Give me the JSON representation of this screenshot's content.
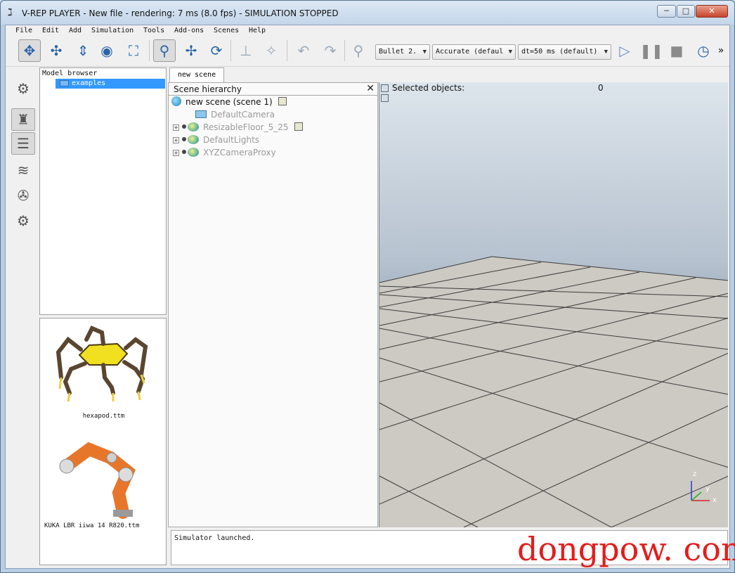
{
  "window": {
    "title": "V-REP PLAYER - New file - rendering: 7 ms (8.0 fps) - SIMULATION STOPPED",
    "minimize": "─",
    "maximize": "□",
    "close": "✕"
  },
  "menu": [
    "File",
    "Edit",
    "Add",
    "Simulation",
    "Tools",
    "Add-ons",
    "Scenes",
    "Help"
  ],
  "toolbar": {
    "engine": "Bullet 2.",
    "accuracy": "Accurate (defaul",
    "timestep": "dt=50 ms (default)",
    "more": "»"
  },
  "model_browser": {
    "header": "Model browser",
    "items": [
      {
        "label": "examples"
      }
    ],
    "thumbnails": [
      {
        "label": "hexapod.ttm"
      },
      {
        "label": "KUKA LBR iiwa 14 R820.ttm"
      }
    ]
  },
  "tab": {
    "label": "new scene"
  },
  "scene_hierarchy": {
    "title": "Scene hierarchy",
    "close": "✕",
    "root": "new scene (scene 1)",
    "objects": [
      "DefaultCamera",
      "ResizableFloor_5_25",
      "DefaultLights",
      "XYZCameraProxy"
    ]
  },
  "viewport": {
    "selected_label": "Selected objects:",
    "selected_count": "0",
    "axes": {
      "x": "x",
      "y": "y",
      "z": "z"
    }
  },
  "console": {
    "text": "Simulator launched."
  },
  "watermark": "dongpow. com",
  "colors": {
    "selection": "#3399ff",
    "watermark": "#e41c1c",
    "accent": "#2a64a8"
  }
}
